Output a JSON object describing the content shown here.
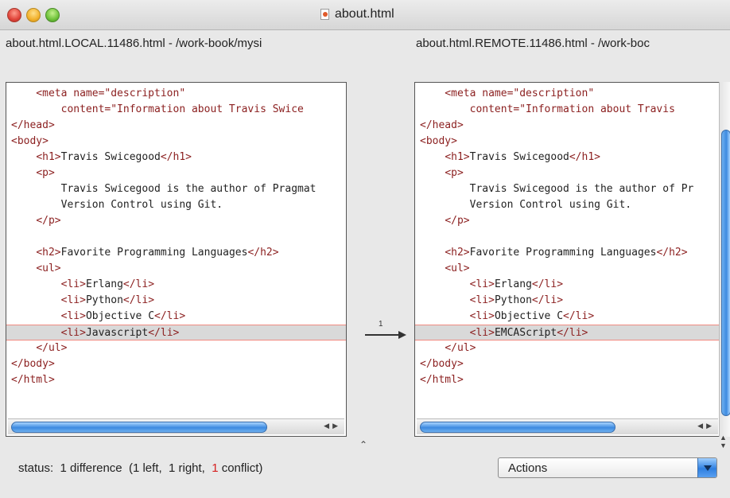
{
  "window": {
    "title": "about.html"
  },
  "files": {
    "left_header": "about.html.LOCAL.11486.html - /work-book/mysi",
    "right_header": "about.html.REMOTE.11486.html - /work-boc"
  },
  "left_lines": [
    "    <meta name=\"description\"",
    "        content=\"Information about Travis Swice",
    "</head>",
    "<body>",
    "    <h1>Travis Swicegood</h1>",
    "    <p>",
    "        Travis Swicegood is the author of Pragmat",
    "        Version Control using Git.",
    "    </p>",
    "",
    "    <h2>Favorite Programming Languages</h2>",
    "    <ul>",
    "        <li>Erlang</li>",
    "        <li>Python</li>",
    "        <li>Objective C</li>",
    "        <li>Javascript</li>",
    "    </ul>",
    "</body>",
    "</html>"
  ],
  "right_lines": [
    "    <meta name=\"description\"",
    "        content=\"Information about Travis",
    "</head>",
    "<body>",
    "    <h1>Travis Swicegood</h1>",
    "    <p>",
    "        Travis Swicegood is the author of Pr",
    "        Version Control using Git.",
    "    </p>",
    "",
    "    <h2>Favorite Programming Languages</h2>",
    "    <ul>",
    "        <li>Erlang</li>",
    "        <li>Python</li>",
    "        <li>Objective C</li>",
    "        <li>EMCAScript</li>",
    "    </ul>",
    "</body>",
    "</html>"
  ],
  "diff": {
    "line_index": 15,
    "number": "1"
  },
  "status": {
    "prefix": "status:  1 difference  (1 left,  1 right,  ",
    "conflict_count": "1",
    "suffix": " conflict)"
  },
  "actions": {
    "label": "Actions"
  },
  "icons": {
    "close": "close-button-icon",
    "minimize": "minimize-button-icon",
    "zoom": "zoom-button-icon",
    "document": "html-document-icon",
    "diff_arrow": "right-arrow-icon",
    "dropdown": "chevron-down-icon"
  },
  "colors": {
    "diff_highlight": "#d9d9d9",
    "diff_border": "#f08a80",
    "tag_color": "#8b1f1f",
    "conflict_red": "#d62020",
    "scroll_blue": "#3d8ae0"
  }
}
